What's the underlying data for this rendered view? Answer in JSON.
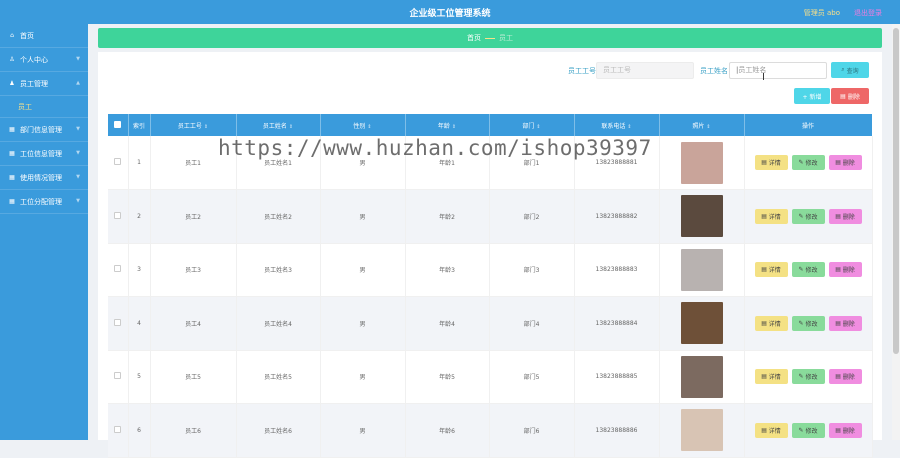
{
  "header": {
    "title": "企业级工位管理系统",
    "admin_label": "管理员 abo",
    "logout_label": "退出登录"
  },
  "sidebar": {
    "items": [
      {
        "label": "首页",
        "icon": "home-icon"
      },
      {
        "label": "个人中心",
        "icon": "user-icon"
      },
      {
        "label": "员工管理",
        "icon": "users-icon"
      },
      {
        "label": "部门信息管理",
        "icon": "grid-icon"
      },
      {
        "label": "工位信息管理",
        "icon": "grid-icon"
      },
      {
        "label": "使用情况管理",
        "icon": "grid-icon"
      },
      {
        "label": "工位分配管理",
        "icon": "grid-icon"
      }
    ],
    "sub_item": "员工"
  },
  "breadcrumb": {
    "home": "首页",
    "current": "员工"
  },
  "search": {
    "employee_no_label": "员工工号",
    "employee_no_placeholder": "员工工号",
    "employee_name_label": "员工姓名",
    "employee_name_placeholder": "员工姓名",
    "search_button": "查询"
  },
  "actions": {
    "add_button": "+ 新增",
    "delete_button": "删除"
  },
  "table": {
    "headers": [
      "索引",
      "员工工号",
      "员工姓名",
      "性别",
      "年龄",
      "部门",
      "联系电话",
      "照片",
      "操作"
    ],
    "row_buttons": {
      "detail": "详情",
      "edit": "修改",
      "remove": "删除"
    },
    "rows": [
      {
        "index": "1",
        "no": "员工1",
        "name": "员工姓名1",
        "gender": "男",
        "age": "年龄1",
        "dept": "部门1",
        "phone": "13823888881",
        "photo_color": "#c9a49a"
      },
      {
        "index": "2",
        "no": "员工2",
        "name": "员工姓名2",
        "gender": "男",
        "age": "年龄2",
        "dept": "部门2",
        "phone": "13823888882",
        "photo_color": "#5b4a3e"
      },
      {
        "index": "3",
        "no": "员工3",
        "name": "员工姓名3",
        "gender": "男",
        "age": "年龄3",
        "dept": "部门3",
        "phone": "13823888883",
        "photo_color": "#b8b2b0"
      },
      {
        "index": "4",
        "no": "员工4",
        "name": "员工姓名4",
        "gender": "男",
        "age": "年龄4",
        "dept": "部门4",
        "phone": "13823888884",
        "photo_color": "#6e5038"
      },
      {
        "index": "5",
        "no": "员工5",
        "name": "员工姓名5",
        "gender": "男",
        "age": "年龄5",
        "dept": "部门5",
        "phone": "13823888885",
        "photo_color": "#7c6a60"
      },
      {
        "index": "6",
        "no": "员工6",
        "name": "员工姓名6",
        "gender": "男",
        "age": "年龄6",
        "dept": "部门6",
        "phone": "13823888886",
        "photo_color": "#d8c4b4"
      }
    ]
  },
  "watermark": "https://www.huzhan.com/ishop39397"
}
